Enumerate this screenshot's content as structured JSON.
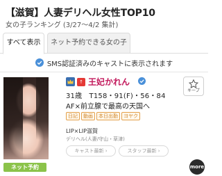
{
  "header": {
    "title": "【滋賀】人妻デリヘル女性TOP10",
    "subtitle": "女の子ランキング (3/27〜4/2 集計)"
  },
  "tabs": [
    {
      "label": "すべて表示",
      "active": true
    },
    {
      "label": "ネット予約できる女の子",
      "active": false
    }
  ],
  "notice": {
    "text": "SMS認証済みのキャストに表示されます",
    "icon": "verified-check-icon",
    "color": "#4a90d9"
  },
  "cast": {
    "name": "王妃かれん",
    "rank_icon": "crown-icon",
    "rank_badge": "↑",
    "stats": "31歳　T158・91(F)・56・84",
    "catch_copy": "AF×前立腺で最高の天国へ",
    "tags": [
      "日記",
      "動画",
      "本日出勤",
      "ヨヤク"
    ],
    "shop": "LIP×LIP滋賀",
    "area": "デリヘル(人妻/守山・草津)",
    "favorite_label": "キープ",
    "buttons": {
      "cast_news": "キャスト最新 ›",
      "staff_news": "スタッフ最新 ›"
    },
    "net_reservation": "ネット予約"
  },
  "more_button": "more",
  "colors": {
    "name": "#c2185b",
    "tag": "#e3a04a",
    "net_tag": "#8bc34a",
    "verified": "#4a90d9"
  }
}
